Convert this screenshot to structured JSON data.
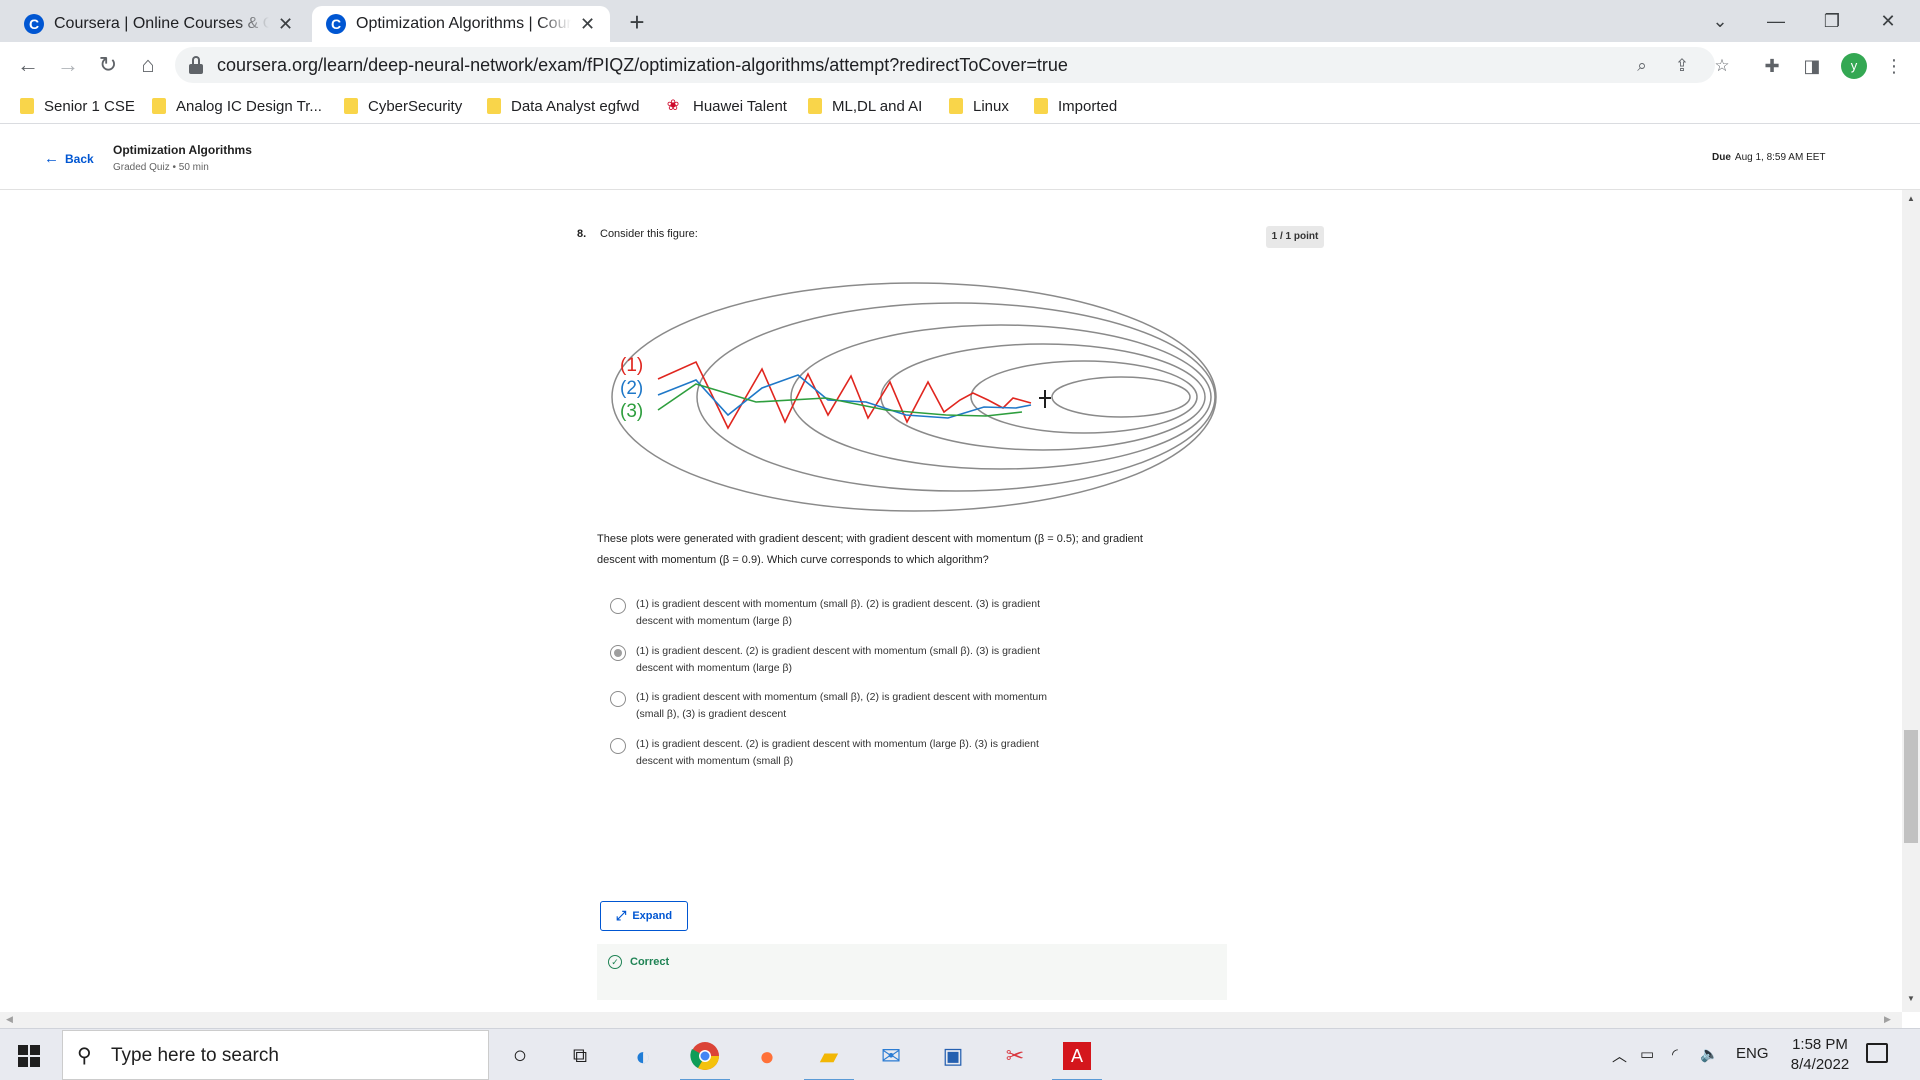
{
  "browser": {
    "tabs": [
      {
        "title": "Coursera | Online Courses & Credentials From Top Educators",
        "favicon": "coursera-icon",
        "close": "✕"
      },
      {
        "title": "Optimization Algorithms | Coursera",
        "favicon": "coursera-icon",
        "close": "✕"
      }
    ],
    "new_tab": "+",
    "url": "coursera.org/learn/deep-neural-network/exam/fPIQZ/optimization-algorithms/attempt?redirectToCover=true",
    "profile_initial": "y",
    "bookmarks": [
      {
        "label": "Senior 1 CSE",
        "icon": "folder-icon"
      },
      {
        "label": "Analog IC Design Tr...",
        "icon": "folder-icon"
      },
      {
        "label": "CyberSecurity",
        "icon": "folder-icon"
      },
      {
        "label": "Data Analyst egfwd",
        "icon": "folder-icon"
      },
      {
        "label": "Huawei Talent",
        "icon": "huawei-icon"
      },
      {
        "label": "ML,DL and AI",
        "icon": "folder-icon"
      },
      {
        "label": "Linux",
        "icon": "folder-icon"
      },
      {
        "label": "Imported",
        "icon": "folder-icon"
      }
    ]
  },
  "header": {
    "back_label": "Back",
    "quiz_title": "Optimization Algorithms",
    "quiz_subtitle": "Graded Quiz • 50 min",
    "due_label": "Due",
    "due_value": "Aug 1, 8:59 AM EET"
  },
  "question": {
    "number": "8.",
    "text": "Consider this figure:",
    "points": "1 / 1 point",
    "figure_labels": [
      "(1)",
      "(2)",
      "(3)"
    ],
    "figure_colors": {
      "curve1": "#e0261f",
      "curve2": "#1f78c8",
      "curve3": "#2e9e3e",
      "contour": "#8a8a8a"
    },
    "description_line1": "These plots were generated with gradient descent; with gradient descent with momentum (β = 0.5); and gradient",
    "description_line2": "descent with momentum (β = 0.9). Which curve corresponds to which algorithm?",
    "options": [
      {
        "line1": "(1) is gradient descent with momentum (small β). (2) is gradient descent. (3) is gradient",
        "line2": "descent with momentum (large β)",
        "selected": false
      },
      {
        "line1": "(1) is gradient descent. (2) is gradient descent with momentum (small β). (3) is gradient",
        "line2": "descent with momentum (large β)",
        "selected": true
      },
      {
        "line1": "(1) is gradient descent with momentum (small β), (2) is gradient descent with momentum",
        "line2": "(small β), (3) is gradient descent",
        "selected": false
      },
      {
        "line1": "(1) is gradient descent. (2) is gradient descent with momentum (large β). (3) is gradient",
        "line2": "descent with momentum (small β)",
        "selected": false
      }
    ],
    "expand_label": "Expand",
    "feedback_label": "Correct"
  },
  "taskbar": {
    "search_placeholder": "Type here to search",
    "language": "ENG",
    "time": "1:58 PM",
    "date": "8/4/2022"
  }
}
